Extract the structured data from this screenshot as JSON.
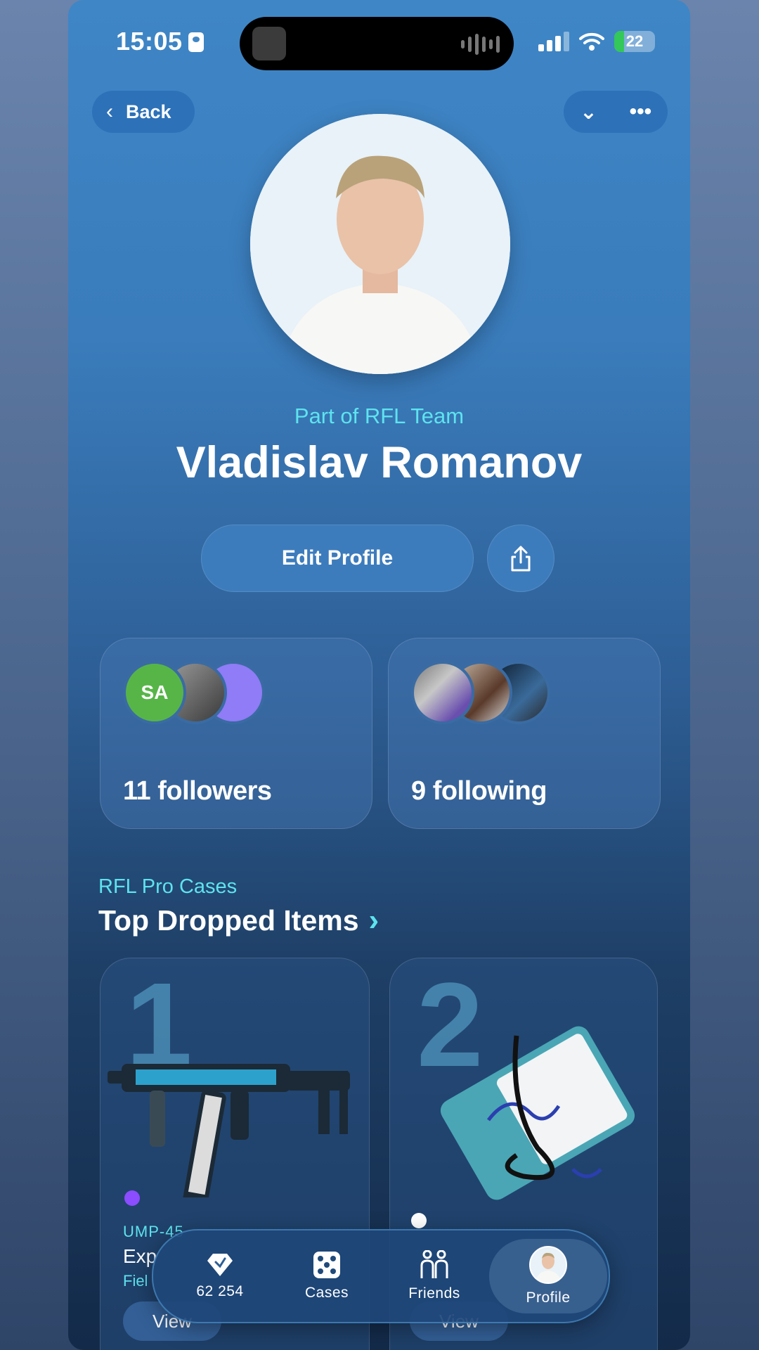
{
  "status_bar": {
    "time": "15:05",
    "battery": "22"
  },
  "nav": {
    "back_label": "Back"
  },
  "profile": {
    "team": "Part of RFL Team",
    "name": "Vladislav Romanov",
    "edit_label": "Edit Profile"
  },
  "followers": {
    "avatar_initials": "SA",
    "label": "11 followers"
  },
  "following": {
    "label": "9 following"
  },
  "section": {
    "subtitle": "RFL Pro Cases",
    "title": "Top Dropped Items"
  },
  "items": [
    {
      "rank": "1",
      "type": "UMP-45",
      "name": "Exp",
      "wear": "Fiel",
      "view_label": "View",
      "rarity_color": "#8b4dff"
    },
    {
      "rank": "2",
      "view_label": "View",
      "rarity_color": "#ffffff"
    }
  ],
  "tabbar": {
    "coins": "62 254",
    "cases": "Cases",
    "friends": "Friends",
    "profile": "Profile"
  },
  "colors": {
    "accent": "#5ee3ee",
    "brand": "#2d71b8"
  }
}
